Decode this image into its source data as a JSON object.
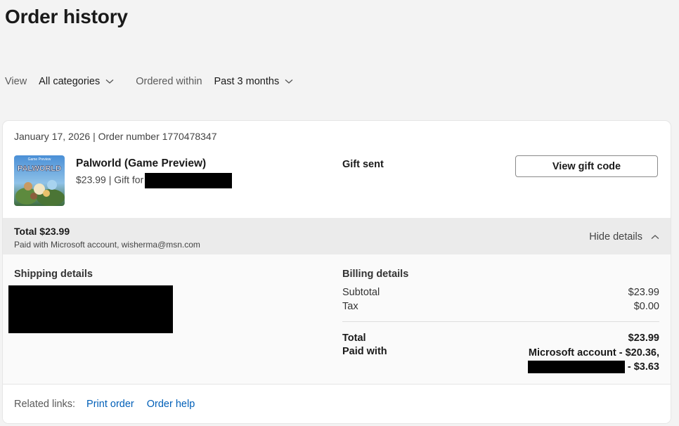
{
  "page": {
    "title": "Order history"
  },
  "filters": {
    "view_label": "View",
    "category_value": "All categories",
    "ordered_within_label": "Ordered within",
    "ordered_within_value": "Past 3 months"
  },
  "order": {
    "meta": "January 17, 2026 | Order number 1770478347",
    "product": {
      "name": "Palworld (Game Preview)",
      "price_gift": "$23.99 | Gift for",
      "thumb_caption": "Game Preview",
      "thumb_logo": "PALWORLD"
    },
    "gift_status": "Gift sent",
    "gift_button": "View gift code",
    "summary": {
      "total": "Total $23.99",
      "paid_with": "Paid with Microsoft account, wisherma@msn.com",
      "hide_details": "Hide details"
    },
    "shipping": {
      "heading": "Shipping details"
    },
    "billing": {
      "heading": "Billing details",
      "subtotal_label": "Subtotal",
      "subtotal_value": "$23.99",
      "tax_label": "Tax",
      "tax_value": "$0.00",
      "total_label": "Total",
      "total_value": "$23.99",
      "paid_with_label": "Paid with",
      "paid_with_line1": "Microsoft account - $20.36,",
      "paid_with_line2_suffix": "- $3.63"
    },
    "related": {
      "label": "Related links:",
      "print": "Print order",
      "help": "Order help"
    }
  },
  "colors": {
    "link": "#005fb8",
    "summary_bg": "#ebebeb",
    "page_bg": "#f3f3f3"
  }
}
